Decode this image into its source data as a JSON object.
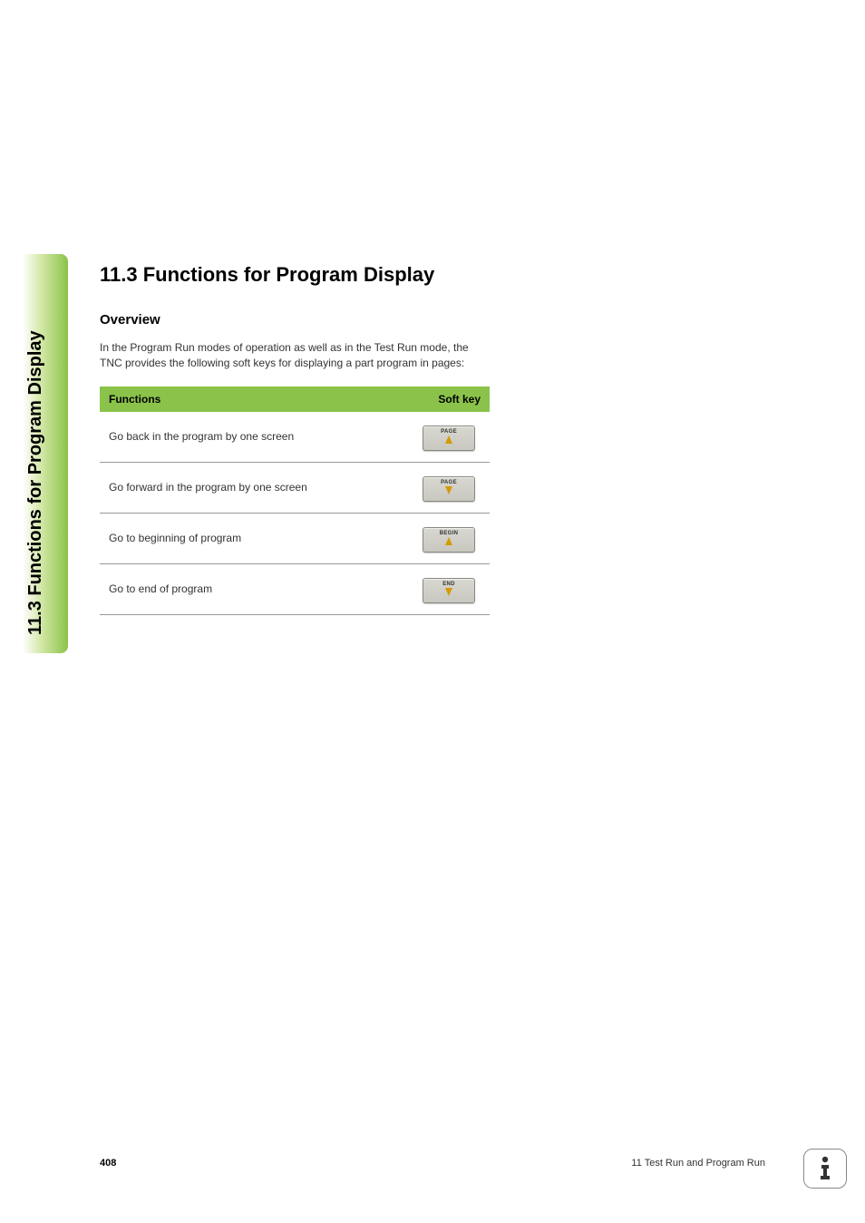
{
  "sidebar": {
    "label": "11.3 Functions for Program Display"
  },
  "content": {
    "heading": "11.3 Functions for Program Display",
    "subheading": "Overview",
    "intro": "In the Program Run modes of operation as well as in the Test Run mode, the TNC provides the following soft keys for displaying a part program in pages:",
    "table": {
      "header_functions": "Functions",
      "header_softkey": "Soft key",
      "rows": [
        {
          "func": "Go back in the program by one screen",
          "key_label": "PAGE",
          "arrow": "up"
        },
        {
          "func": "Go forward in the program by one screen",
          "key_label": "PAGE",
          "arrow": "down"
        },
        {
          "func": "Go to beginning of program",
          "key_label": "BEGIN",
          "arrow": "up"
        },
        {
          "func": "Go to end of program",
          "key_label": "END",
          "arrow": "down"
        }
      ]
    }
  },
  "footer": {
    "page_number": "408",
    "chapter": "11 Test Run and Program Run"
  }
}
